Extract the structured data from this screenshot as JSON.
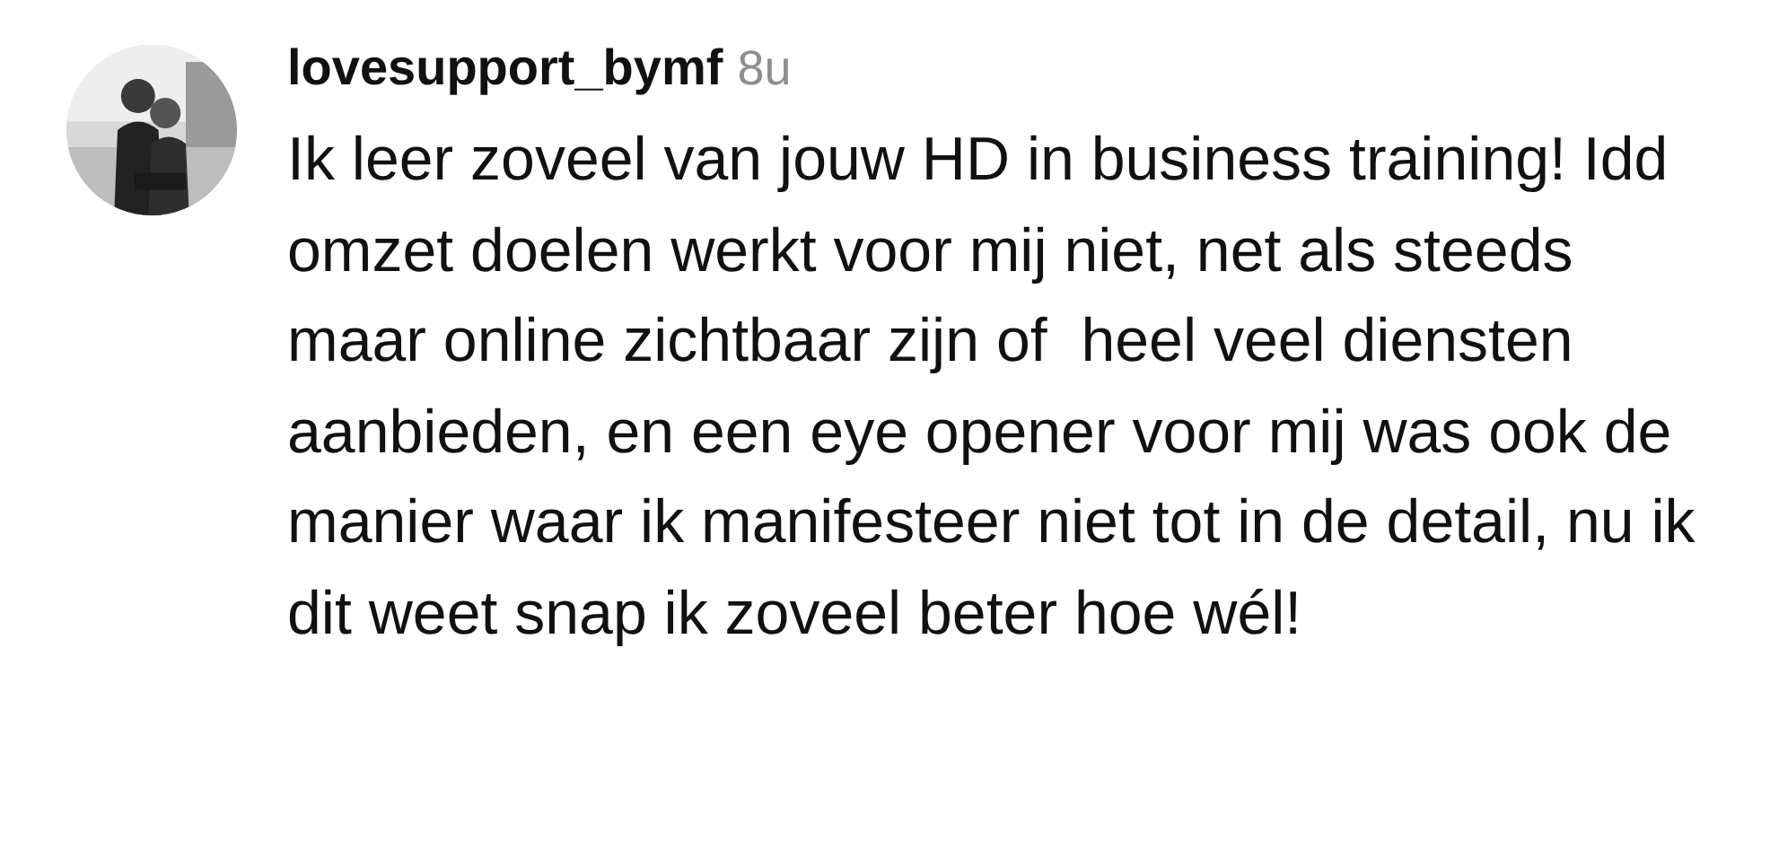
{
  "comment": {
    "username": "lovesupport_bymf",
    "time": "8u",
    "text": "Ik leer zoveel van jouw HD in business training! Idd omzet doelen werkt voor mij niet, net als steeds maar online zichtbaar zijn of  heel veel diensten aanbieden, en een eye opener voor mij was ook de manier waar ik manifesteer niet tot in de detail, nu ik dit weet snap ik zoveel beter hoe wél!"
  }
}
